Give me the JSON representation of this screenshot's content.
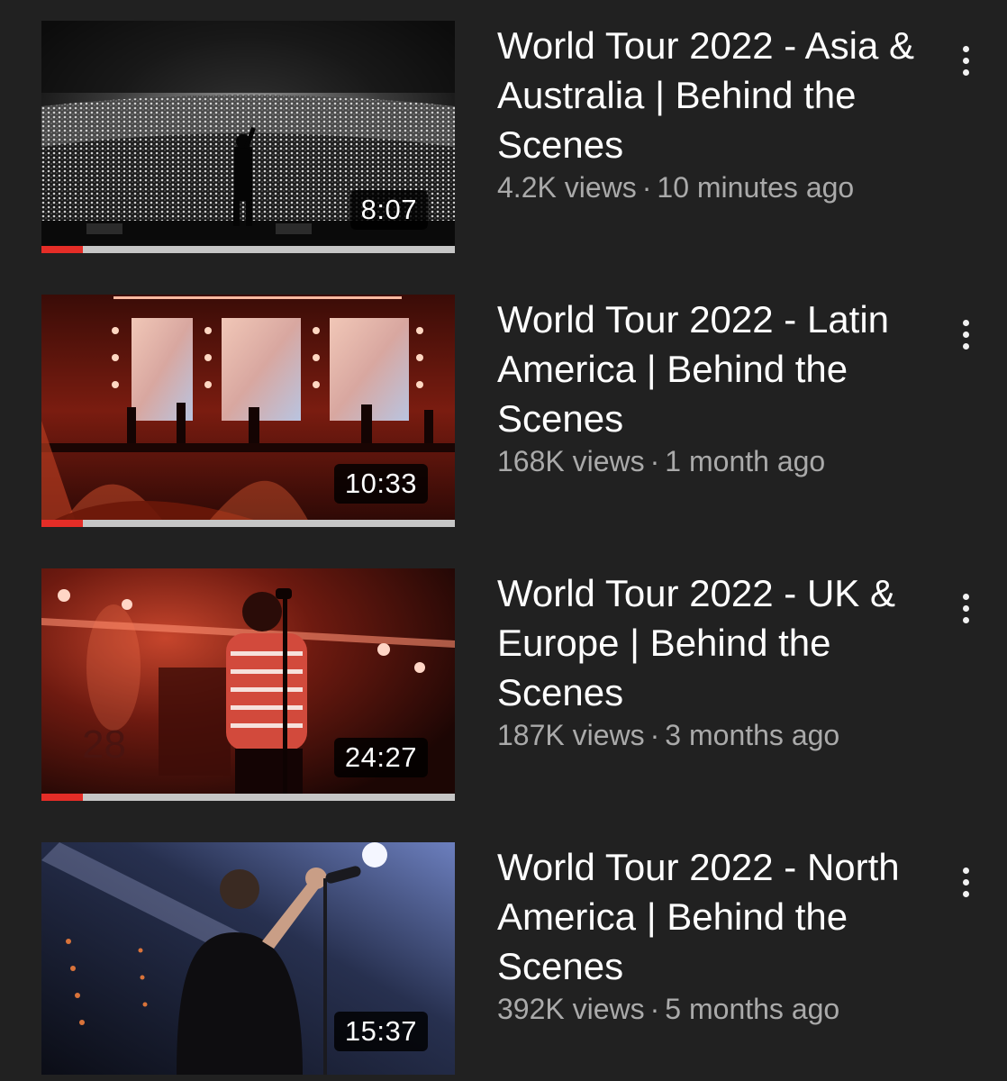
{
  "videos": [
    {
      "title": "World Tour 2022 - Asia & Australia | Behind the Scenes",
      "views": "4.2K views",
      "separator": "·",
      "age": "10 minutes ago",
      "duration": "8:07",
      "watched_fraction": 0.1,
      "thumbnail": "black-and-white arena concert crowd from stage",
      "more_icon": "vertical-ellipsis-icon"
    },
    {
      "title": "World Tour 2022 - Latin America | Behind the Scenes",
      "views": "168K views",
      "separator": "·",
      "age": "1 month ago",
      "duration": "10:33",
      "watched_fraction": 0.1,
      "thumbnail": "red-lit stage with band and video screens",
      "more_icon": "vertical-ellipsis-icon"
    },
    {
      "title": "World Tour 2022 - UK & Europe | Behind the Scenes",
      "views": "187K views",
      "separator": "·",
      "age": "3 months ago",
      "duration": "24:27",
      "watched_fraction": 0.1,
      "thumbnail": "singer at microphone under red lights",
      "more_icon": "vertical-ellipsis-icon"
    },
    {
      "title": "World Tour 2022 - North America | Behind the Scenes",
      "views": "392K views",
      "separator": "·",
      "age": "5 months ago",
      "duration": "15:37",
      "watched_fraction": 0,
      "thumbnail": "singer holding microphone stand under blue spotlight",
      "more_icon": "vertical-ellipsis-icon"
    }
  ],
  "colors": {
    "background": "#212121",
    "progress": "#e52d27",
    "progress_track": "#c6c6c6",
    "title": "#ffffff",
    "meta": "#aaaaaa"
  }
}
